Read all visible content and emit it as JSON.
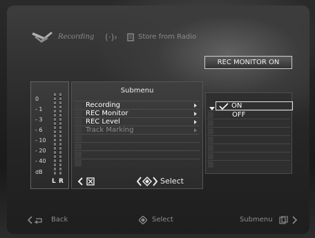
{
  "top_nav": {
    "recording_label": "Recording",
    "radio_label": "Store from Radio"
  },
  "badge": {
    "text": "REC MONITOR ON"
  },
  "vu_meter": {
    "scale": [
      "0",
      "- 1",
      "- 3",
      "- 6",
      "- 10",
      "- 20",
      "- 40",
      "dB"
    ],
    "left_channel": "L",
    "right_channel": "R"
  },
  "submenu": {
    "title": "Submenu",
    "items": [
      {
        "label": "Recording",
        "enabled": true
      },
      {
        "label": "REC Monitor",
        "enabled": true
      },
      {
        "label": "REC Level",
        "enabled": true
      },
      {
        "label": "Track Marking",
        "enabled": false
      }
    ],
    "footer_select": "Select"
  },
  "options": {
    "items": [
      {
        "label": "ON",
        "selected": true
      },
      {
        "label": "OFF",
        "selected": false
      }
    ]
  },
  "bottom_bar": {
    "back": "Back",
    "select": "Select",
    "submenu": "Submenu"
  },
  "colors": {
    "background": "#262626",
    "text": "#f0f0f0",
    "dim_text": "#8c8c8c"
  }
}
